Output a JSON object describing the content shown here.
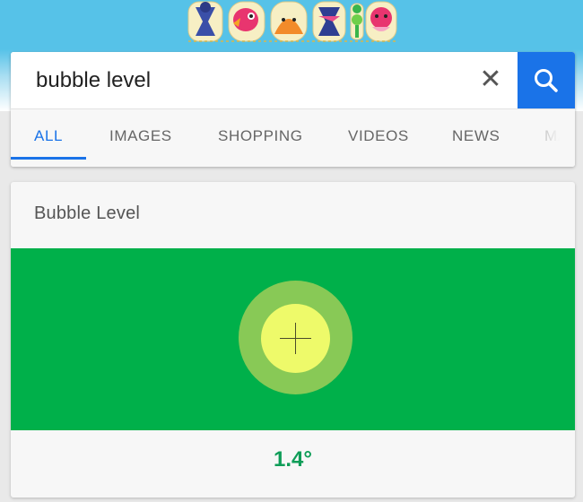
{
  "search": {
    "query": "bubble level",
    "clear_glyph": "✕",
    "button_icon": "search-icon"
  },
  "tabs": [
    {
      "label": "ALL",
      "active": true
    },
    {
      "label": "IMAGES",
      "active": false
    },
    {
      "label": "SHOPPING",
      "active": false
    },
    {
      "label": "VIDEOS",
      "active": false
    },
    {
      "label": "NEWS",
      "active": false
    },
    {
      "label": "MA",
      "active": false
    }
  ],
  "card": {
    "title": "Bubble Level",
    "angle": "1.4°"
  },
  "colors": {
    "accent": "#1a73e8",
    "level_background": "#00b04a",
    "bubble": "#eefa6a",
    "bubble_ring": "#88c956",
    "angle_text": "#0f9d58"
  }
}
